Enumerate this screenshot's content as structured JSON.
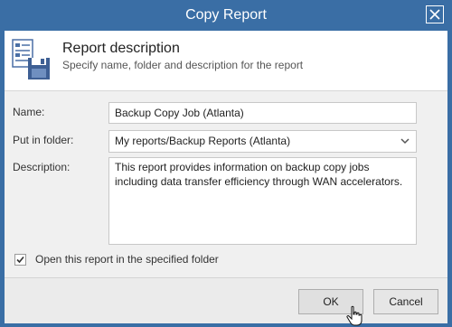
{
  "window": {
    "title": "Copy Report",
    "close_icon": "close-icon"
  },
  "header": {
    "icon": "report-icon",
    "title": "Report description",
    "subtitle": "Specify name, folder and description for the report"
  },
  "form": {
    "name_label": "Name:",
    "name_value": "Backup Copy Job (Atlanta)",
    "folder_label": "Put in folder:",
    "folder_value": "My reports/Backup Reports (Atlanta)",
    "description_label": "Description:",
    "description_value": "This report provides information on backup copy jobs including data transfer efficiency through WAN accelerators.",
    "open_checkbox_label": "Open this report in the specified folder",
    "open_checkbox_checked": true
  },
  "buttons": {
    "ok": "OK",
    "cancel": "Cancel"
  },
  "colors": {
    "titlebar": "#3a6ea5",
    "body": "#f0f0f0"
  }
}
